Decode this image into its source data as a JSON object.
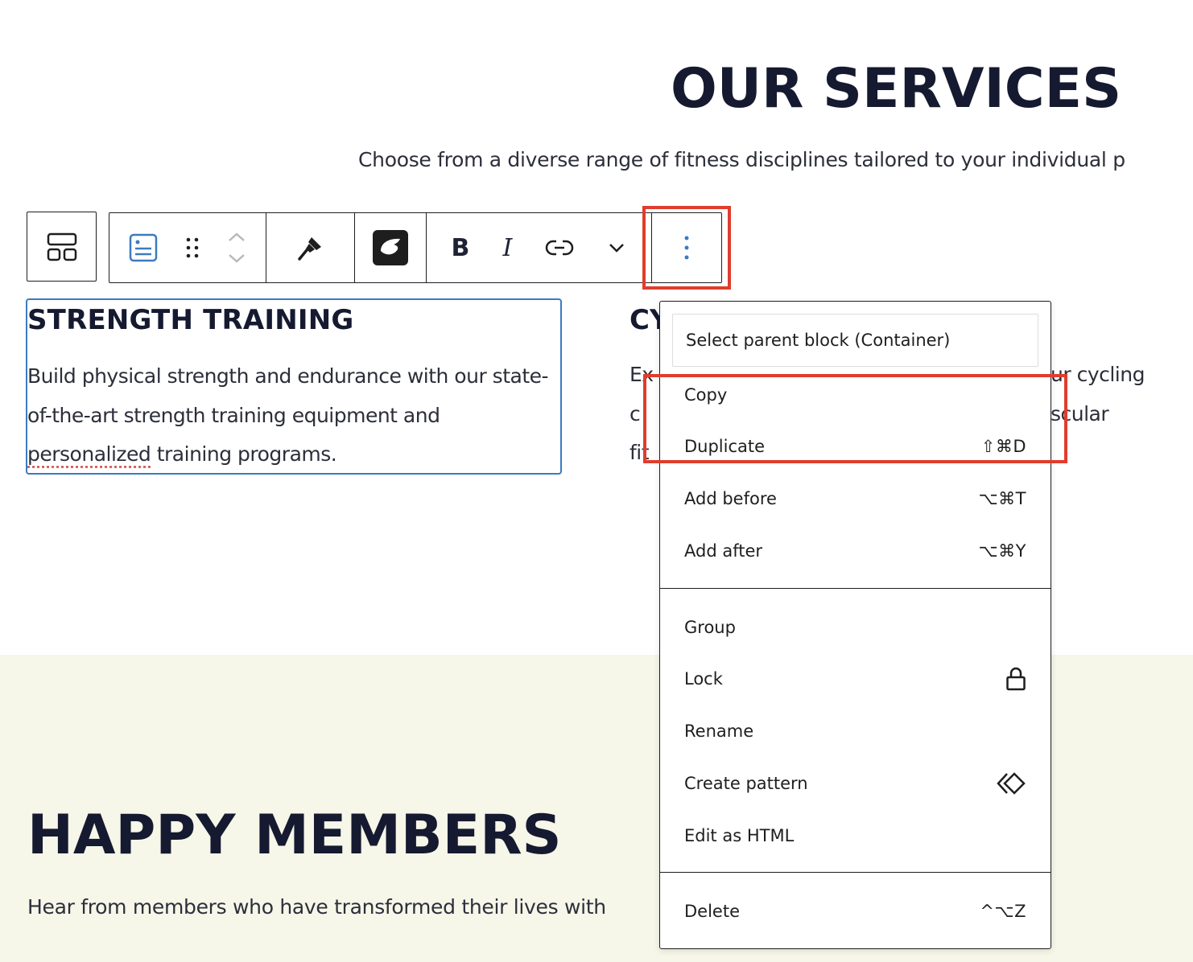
{
  "services": {
    "title": "OUR SERVICES",
    "subtitle": "Choose from a diverse range of fitness disciplines tailored to your individual p"
  },
  "toolbar": {
    "parent_icon": "parent-container-icon",
    "block_type_icon": "block-card-icon",
    "drag_icon": "drag-handle-icon",
    "move_icon": "move-up-down-icon",
    "style_icon": "paintbrush-icon",
    "plugin_icon": "plugin-leaf-icon",
    "bold_label": "B",
    "italic_label": "I",
    "link_icon": "link-icon",
    "more_rich_icon": "chevron-down-icon",
    "options_icon": "more-vertical-icon"
  },
  "strength": {
    "title": "STRENGTH TRAINING",
    "text_before": "Build physical strength and endurance with our state-of-the-art strength training equipment and ",
    "text_misspelled": "personalized",
    "text_after": " training programs."
  },
  "cycling": {
    "title_partial": "CY",
    "line1_left": "Ex",
    "line1_right": "ur cycling",
    "line2_left": "c",
    "line2_right": "scular",
    "line3_left": "fit"
  },
  "members": {
    "title": "HAPPY MEMBERS",
    "subtitle": "Hear from members who have transformed their lives with"
  },
  "menu": {
    "select_parent": "Select parent block (Container)",
    "copy": "Copy",
    "duplicate": "Duplicate",
    "duplicate_shortcut": "⇧⌘D",
    "add_before": "Add before",
    "add_before_shortcut": "⌥⌘T",
    "add_after": "Add after",
    "add_after_shortcut": "⌥⌘Y",
    "group": "Group",
    "lock": "Lock",
    "rename": "Rename",
    "create_pattern": "Create pattern",
    "edit_html": "Edit as HTML",
    "delete": "Delete",
    "delete_shortcut": "^⌥Z"
  },
  "colors": {
    "highlight": "#e03d2c",
    "selected_block": "#3b7bc1",
    "accent_icon": "#3b7bc1",
    "band": "#f6f6e9"
  }
}
